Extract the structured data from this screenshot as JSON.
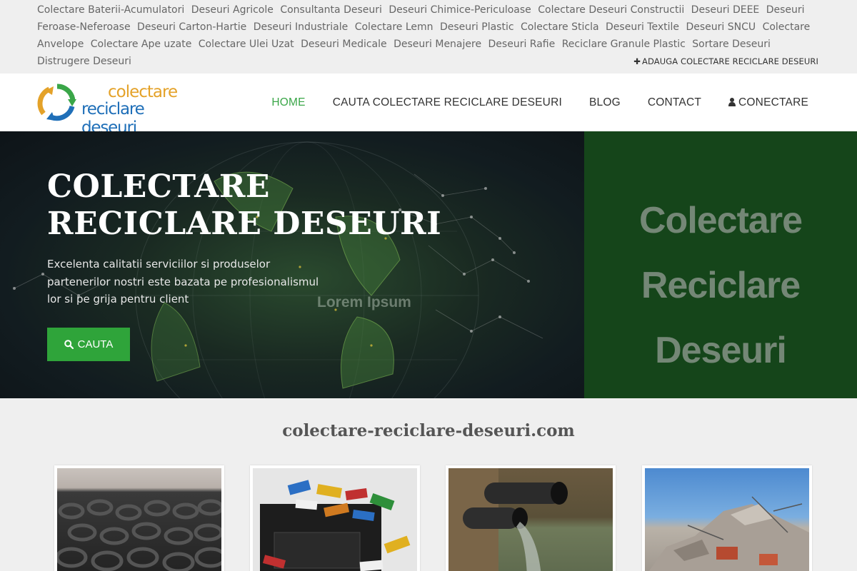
{
  "categories": [
    "Colectare Baterii-Acumulatori",
    "Deseuri Agricole",
    "Consultanta Deseuri",
    "Deseuri Chimice-Periculoase",
    "Colectare Deseuri Constructii",
    "Deseuri DEEE",
    "Deseuri Feroase-Neferoase",
    "Deseuri Carton-Hartie",
    "Deseuri Industriale",
    "Colectare Lemn",
    "Deseuri Plastic",
    "Colectare Sticla",
    "Deseuri Textile",
    "Deseuri SNCU",
    "Colectare Anvelope",
    "Colectare Ape uzate",
    "Colectare Ulei Uzat",
    "Deseuri Medicale",
    "Deseuri Menajere",
    "Deseuri Rafie",
    "Reciclare Granule Plastic",
    "Sortare Deseuri",
    "Distrugere Deseuri"
  ],
  "add_link": "ADAUGA COLECTARE RECICLARE DESEURI",
  "logo": {
    "line1": "colectare",
    "line2": "reciclare deseuri"
  },
  "nav": {
    "home": "HOME",
    "search": "CAUTA COLECTARE RECICLARE DESEURI",
    "blog": "BLOG",
    "contact": "CONTACT",
    "login": "CONECTARE"
  },
  "hero": {
    "title_line1": "COLECTARE",
    "title_line2": "RECICLARE DESEURI",
    "subtitle": "Excelenta calitatii serviciilor si produselor partenerilor nostri este bazata pe profesionalismul lor si pe grija pentru client",
    "watermark": "Lorem Ipsum",
    "button": "CAUTA",
    "right_words": [
      "Colectare",
      "Reciclare",
      "Deseuri"
    ]
  },
  "site_title": "colectare-reciclare-deseuri.com",
  "colors": {
    "accent": "#3aa648",
    "button": "#2fa43a",
    "hero_right": "#15451a"
  }
}
